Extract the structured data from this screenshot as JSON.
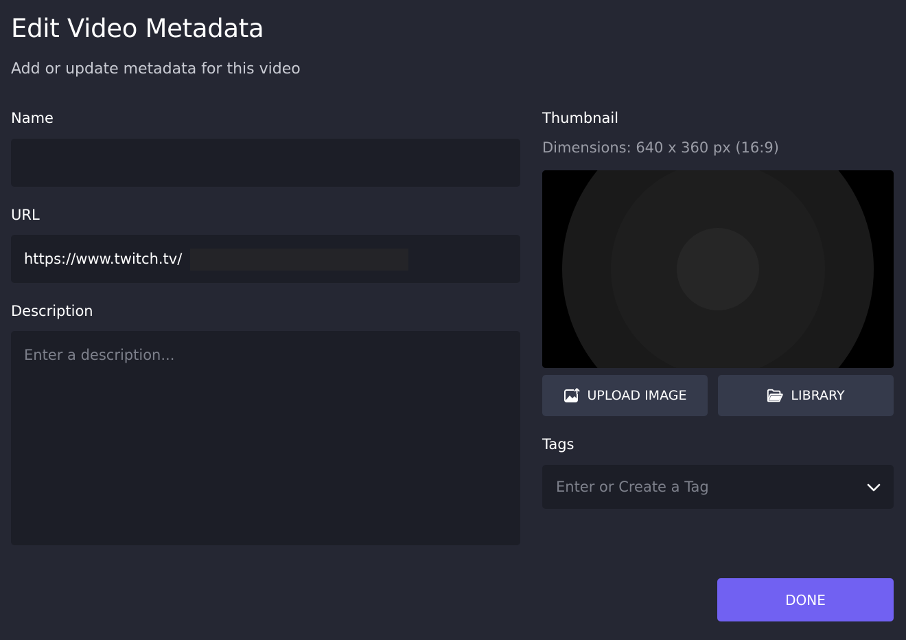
{
  "header": {
    "title": "Edit Video Metadata",
    "subtitle": "Add or update metadata for this video"
  },
  "form": {
    "name": {
      "label": "Name",
      "value": ""
    },
    "url": {
      "label": "URL",
      "value": "https://www.twitch.tv/"
    },
    "description": {
      "label": "Description",
      "placeholder": "Enter a description...",
      "value": ""
    }
  },
  "thumbnail": {
    "label": "Thumbnail",
    "dimensions": "Dimensions: 640 x 360 px (16:9)",
    "upload_label": "UPLOAD IMAGE",
    "library_label": "LIBRARY",
    "upload_icon": "image-upload-icon",
    "library_icon": "folder-open-icon"
  },
  "tags": {
    "label": "Tags",
    "placeholder": "Enter or Create a Tag",
    "icon": "chevron-down-icon"
  },
  "footer": {
    "done_label": "DONE"
  },
  "colors": {
    "background": "#252733",
    "field": "#1c1e27",
    "secondary_button": "#353a4b",
    "primary_button": "#7161f2"
  }
}
